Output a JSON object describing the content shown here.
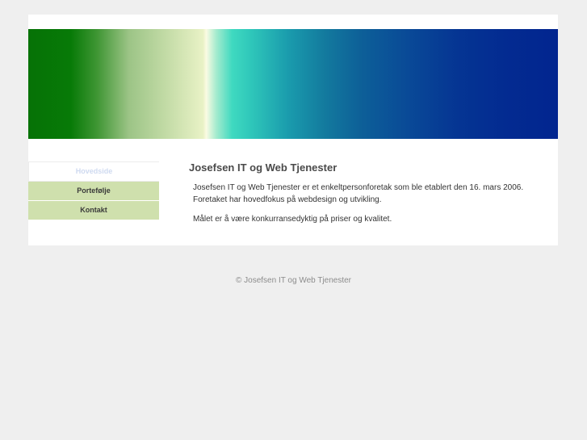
{
  "site": {
    "title": "Josefsen IT og Web Tjenester"
  },
  "nav": {
    "items": [
      {
        "label": "Hovedside",
        "active": true
      },
      {
        "label": "Portefølje",
        "active": false
      },
      {
        "label": "Kontakt",
        "active": false
      }
    ]
  },
  "content": {
    "heading": "Josefsen IT og Web Tjenester",
    "paragraph1": "Josefsen IT og Web Tjenester er et enkeltpersonforetak som ble etablert den 16. mars 2006. Foretaket har hovedfokus på webdesign og utvikling.",
    "paragraph2": "Målet er å være konkurransedyktig på priser og kvalitet."
  },
  "footer": {
    "text": "© Josefsen IT og Web Tjenester"
  },
  "colors": {
    "nav_bg": "#cfe0ad",
    "page_bg": "#efefef",
    "banner_start": "#067206",
    "banner_end": "#02258f"
  }
}
